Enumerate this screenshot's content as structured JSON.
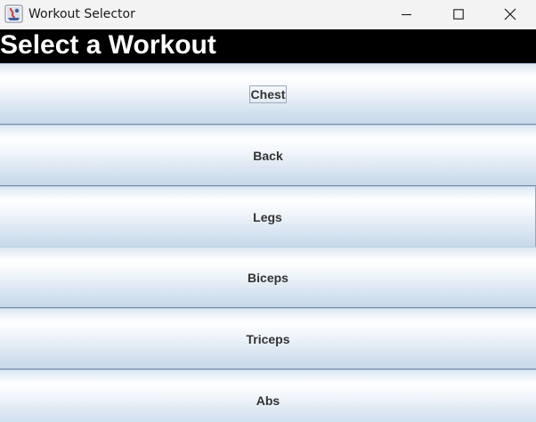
{
  "window": {
    "title": "Workout Selector",
    "icon": "java-app-icon"
  },
  "controls": {
    "minimize_icon": "minimize-icon",
    "maximize_icon": "maximize-icon",
    "close_icon": "close-icon"
  },
  "header": {
    "title": "Select a Workout",
    "background": "#000000",
    "color": "#ffffff"
  },
  "workouts": [
    {
      "label": "Chest",
      "focused": true
    },
    {
      "label": "Back",
      "focused": false
    },
    {
      "label": "Legs",
      "focused": false
    },
    {
      "label": "Biceps",
      "focused": false
    },
    {
      "label": "Triceps",
      "focused": false
    },
    {
      "label": "Abs",
      "focused": false
    }
  ],
  "colors": {
    "button_gradient_top": "#ffffff",
    "button_gradient_bottom": "#c6d8ea",
    "button_text": "#333333"
  }
}
